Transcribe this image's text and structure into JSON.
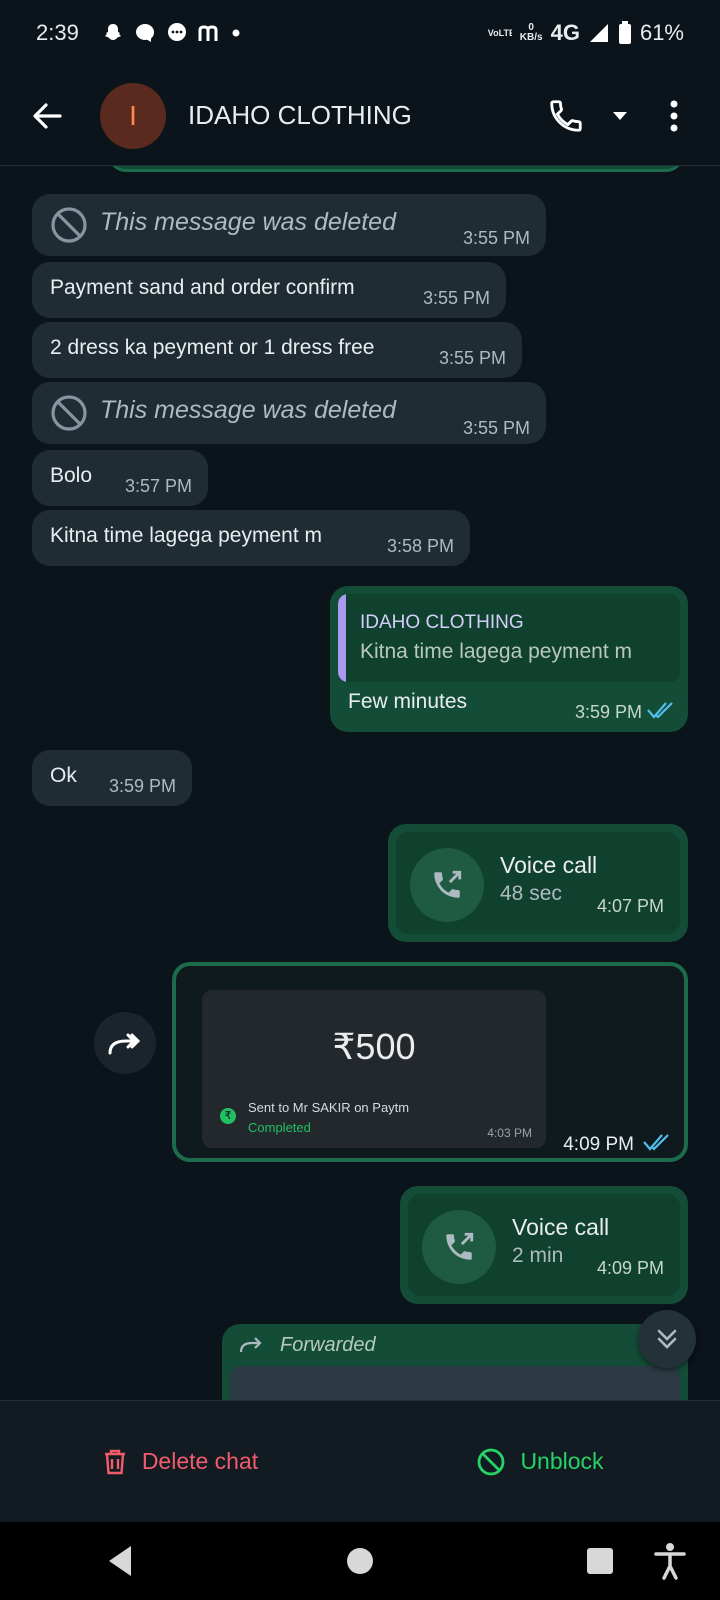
{
  "status_bar": {
    "time": "2:39",
    "network_label": "VoLTE",
    "speed_value": "0",
    "speed_unit": "KB/s",
    "network_type": "4G",
    "battery": "61%"
  },
  "header": {
    "avatar_letter": "I",
    "contact_name": "IDAHO CLOTHING"
  },
  "messages": [
    {
      "type": "deleted",
      "text": "This message was deleted",
      "time": "3:55 PM"
    },
    {
      "type": "text",
      "text": "Payment sand and order confirm",
      "time": "3:55 PM"
    },
    {
      "type": "text",
      "text": "2 dress ka peyment or 1 dress free",
      "time": "3:55 PM"
    },
    {
      "type": "deleted",
      "text": "This message was deleted",
      "time": "3:55 PM"
    },
    {
      "type": "text",
      "text": "Bolo",
      "time": "3:57 PM"
    },
    {
      "type": "text",
      "text": "Kitna time lagega peyment m",
      "time": "3:58 PM"
    },
    {
      "type": "reply",
      "quoted_author": "IDAHO CLOTHING",
      "quoted_text": "Kitna time lagega peyment m",
      "text": "Few minutes",
      "time": "3:59 PM"
    },
    {
      "type": "text",
      "text": "Ok",
      "time": "3:59 PM"
    },
    {
      "type": "voice_call",
      "title": "Voice call",
      "duration": "48 sec",
      "time": "4:07 PM"
    },
    {
      "type": "image",
      "amount": "₹500",
      "sent_to": "Sent to Mr SAKIR on Paytm",
      "status": "Completed",
      "inner_time": "4:03 PM",
      "time": "4:09 PM"
    },
    {
      "type": "voice_call",
      "title": "Voice call",
      "duration": "2 min",
      "time": "4:09 PM"
    },
    {
      "type": "forwarded",
      "label": "Forwarded"
    }
  ],
  "actions": {
    "delete_chat": "Delete chat",
    "unblock": "Unblock"
  },
  "colors": {
    "accent": "#25d366",
    "danger": "#f15c6d",
    "tick_read": "#53bdeb"
  }
}
